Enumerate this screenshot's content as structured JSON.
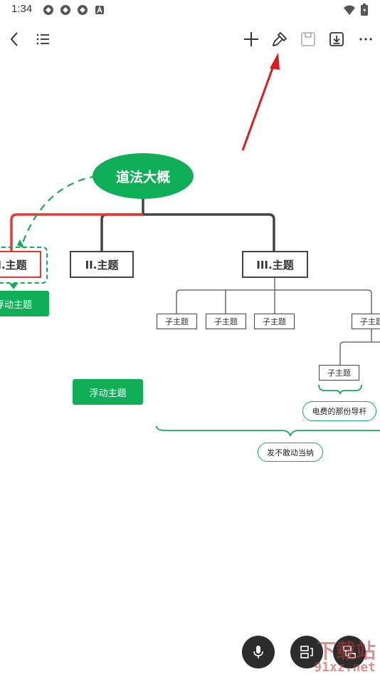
{
  "status_bar": {
    "time": "1:34"
  },
  "toolbar": {
    "back_icon": "chevron-left-icon",
    "outline_icon": "list-icon",
    "add_icon": "plus-icon",
    "format_icon": "paint-brush-icon",
    "save_icon": "save-icon",
    "export_icon": "download-icon",
    "more_icon": "more-icon"
  },
  "mindmap": {
    "root": "道法大概",
    "topics": [
      "I.主题",
      "II.主题",
      "III.主题"
    ],
    "subtopics": [
      "子主题",
      "子主题",
      "子主题",
      "子主题"
    ],
    "nested_subtopic": "子主题",
    "floating_topics": [
      "浮动主题",
      "浮动主题"
    ],
    "callouts": [
      "电费的那份导杆",
      "发不敢动当纳"
    ]
  },
  "watermark": {
    "brand": "下载站",
    "url": "91xz.net"
  },
  "colors": {
    "accent_green": "#0fae57",
    "selection_red": "#e53935",
    "arrow_red": "#d81e1e",
    "line_dark": "#444444"
  }
}
